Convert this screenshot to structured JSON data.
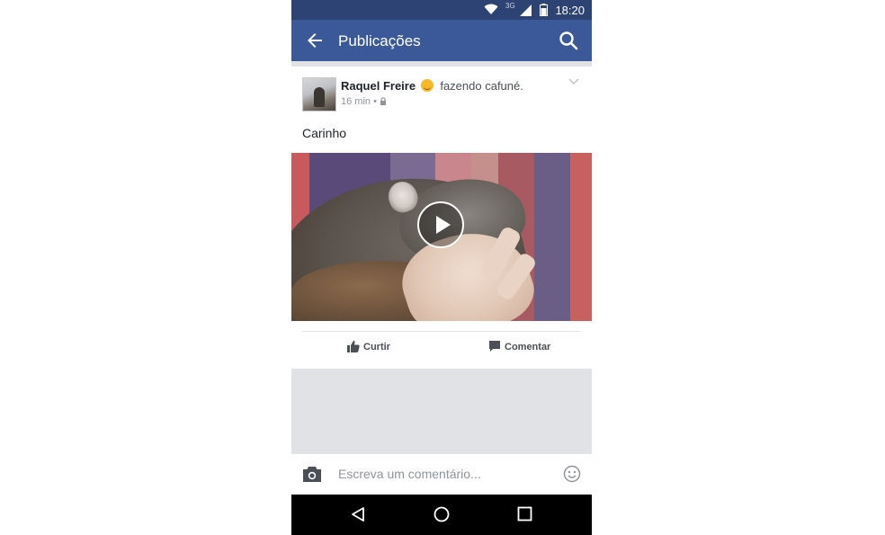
{
  "status_bar": {
    "network": "3G",
    "time": "18:20"
  },
  "app_bar": {
    "title": "Publicações"
  },
  "post": {
    "author": "Raquel Freire",
    "activity": "fazendo cafuné.",
    "timestamp": "16 min",
    "separator": "•",
    "text": "Carinho"
  },
  "actions": {
    "like_label": "Curtir",
    "comment_label": "Comentar"
  },
  "comment_bar": {
    "placeholder": "Escreva um comentário..."
  },
  "icons": {
    "back": "arrow-left-icon",
    "search": "search-icon",
    "privacy": "lock-icon",
    "options": "chevron-down-icon",
    "play": "play-icon",
    "like": "thumbs-up-icon",
    "comment": "comment-icon",
    "camera": "camera-icon",
    "emoji": "smiley-icon"
  },
  "colors": {
    "brand": "#3b5998",
    "status_bar": "#2d4373"
  }
}
